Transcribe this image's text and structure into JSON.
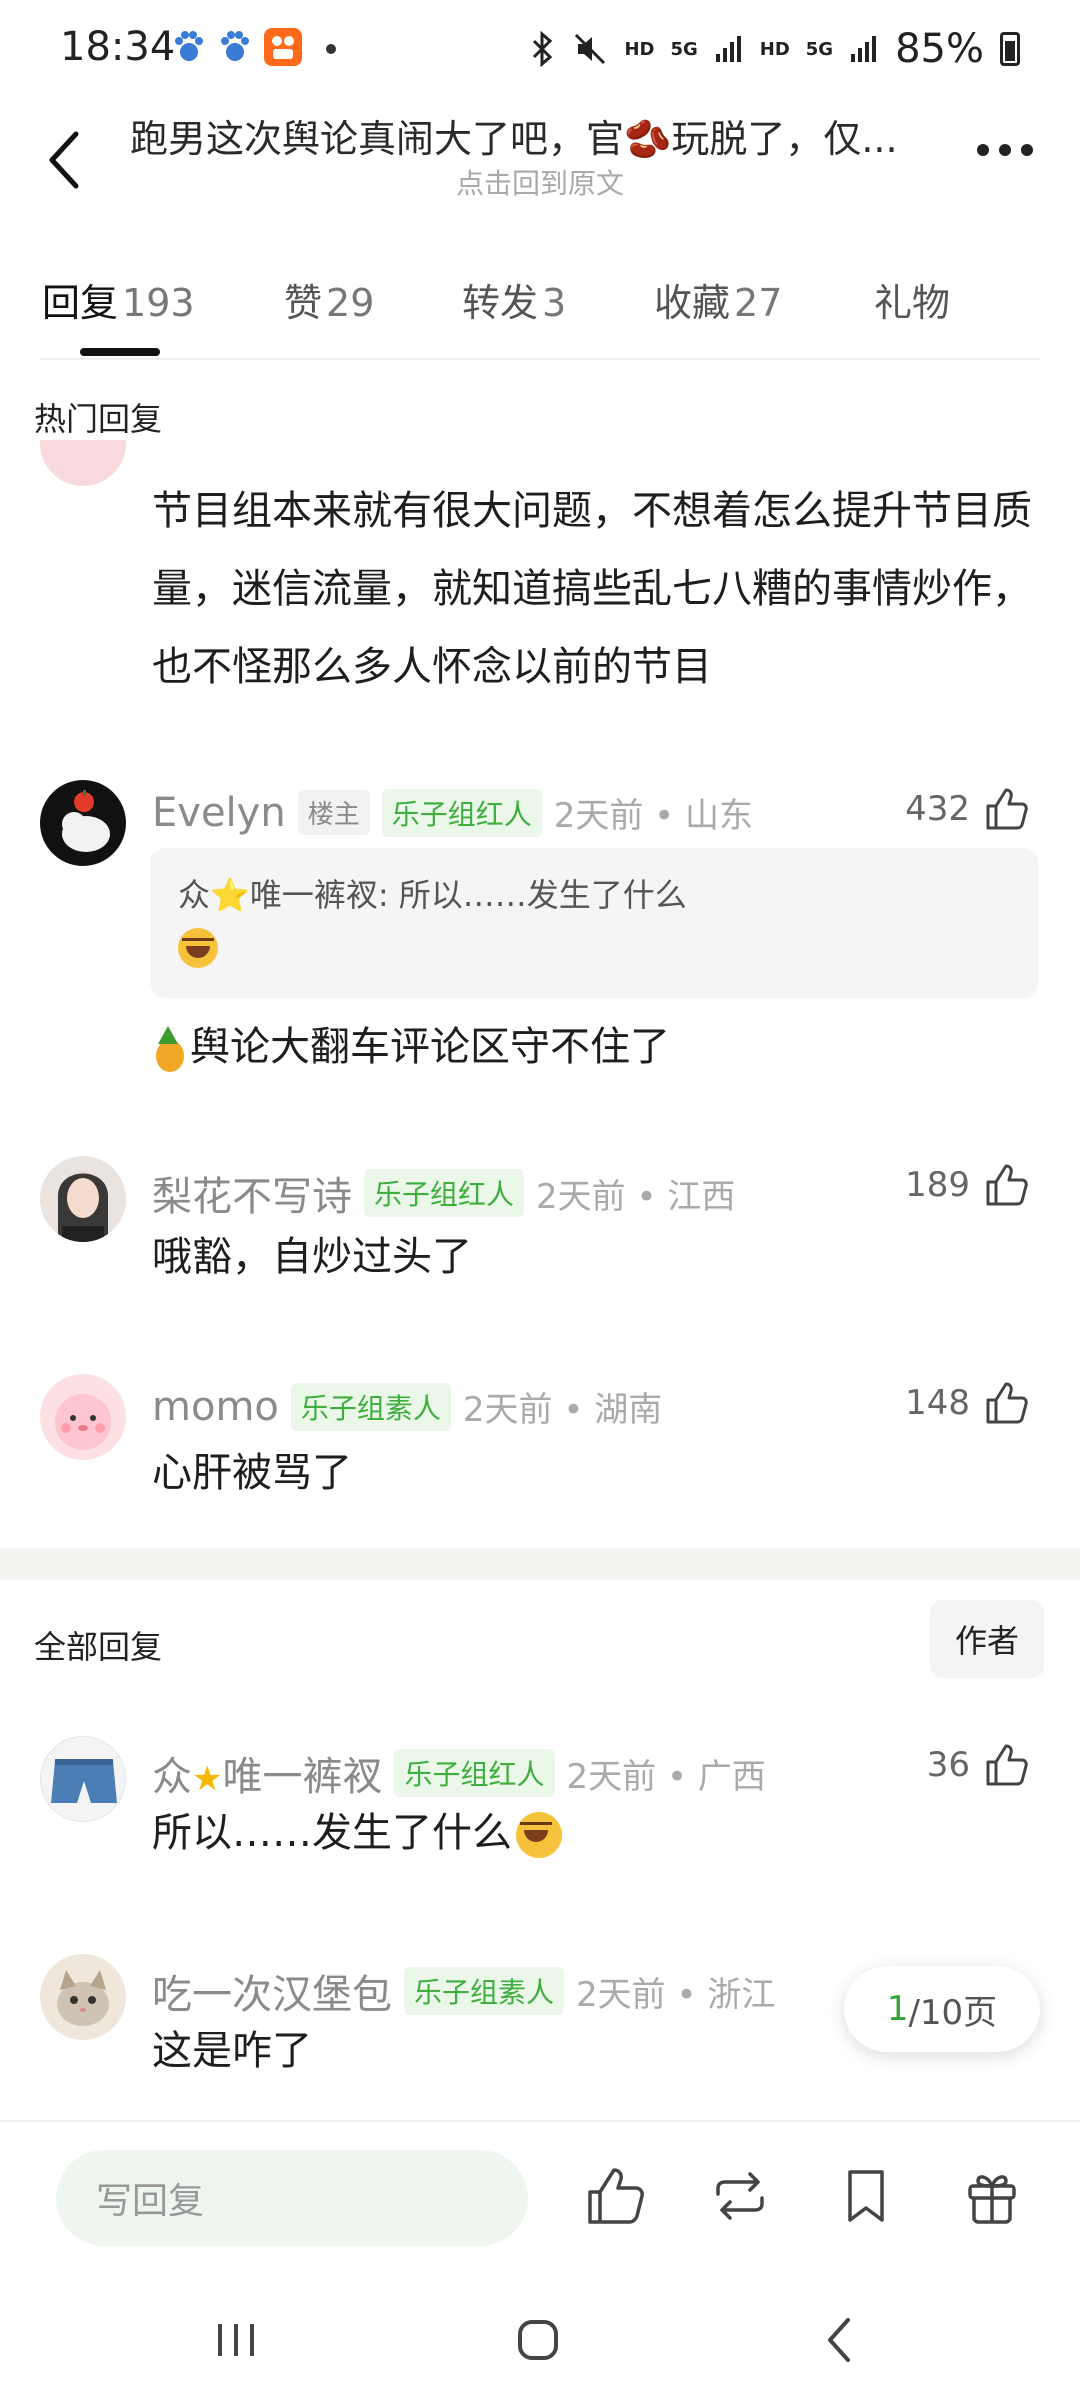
{
  "status_bar": {
    "time": "18:34",
    "right_small_1": "HD",
    "right_small_2": "5G",
    "right_small_3": "HD",
    "right_small_4": "5G",
    "battery": "85%"
  },
  "header": {
    "title": "跑男这次舆论真闹大了吧，官🫘玩脱了，仅...",
    "subtitle": "点击回到原文"
  },
  "tabs": [
    {
      "label": "回复",
      "count": "193"
    },
    {
      "label": "赞",
      "count": "29"
    },
    {
      "label": "转发",
      "count": "3"
    },
    {
      "label": "收藏",
      "count": "27"
    },
    {
      "label": "礼物",
      "count": ""
    }
  ],
  "hot_section": {
    "title": "热门回复",
    "partial_comment_text": "节目组本来就有很大问题，不想着怎么提升节目质量，迷信流量，就知道搞些乱七八糟的事情炒作，也不怪那么多人怀念以前的节目",
    "comments": [
      {
        "username": "Evelyn",
        "owner_badge": "楼主",
        "group_badge": "乐子组红人",
        "time_location": "2天前 • 山东",
        "likes": "432",
        "quote": "众⭐唯一裤衩: 所以……发生了什么",
        "text": "舆论大翻车评论区守不住了"
      },
      {
        "username": "梨花不写诗",
        "group_badge": "乐子组红人",
        "time_location": "2天前 • 江西",
        "likes": "189",
        "text": "哦豁，自炒过头了"
      },
      {
        "username": "momo",
        "group_badge": "乐子组素人",
        "time_location": "2天前 • 湖南",
        "likes": "148",
        "text": "心肝被骂了"
      }
    ]
  },
  "all_section": {
    "title": "全部回复",
    "author_filter": "作者",
    "comments": [
      {
        "username_prefix": "众",
        "username_suffix": "唯一裤衩",
        "group_badge": "乐子组红人",
        "time_location": "2天前 • 广西",
        "likes": "36",
        "text": "所以……发生了什么"
      },
      {
        "username": "吃一次汉堡包",
        "group_badge": "乐子组素人",
        "time_location": "2天前 • 浙江",
        "likes": "",
        "text": "这是咋了"
      }
    ]
  },
  "pagination": {
    "current": "1",
    "total": "/10页"
  },
  "bottom_bar": {
    "reply_placeholder": "写回复"
  },
  "colors": {
    "accent_green": "#3fae3f",
    "badge_bg": "#eaf7e9"
  }
}
